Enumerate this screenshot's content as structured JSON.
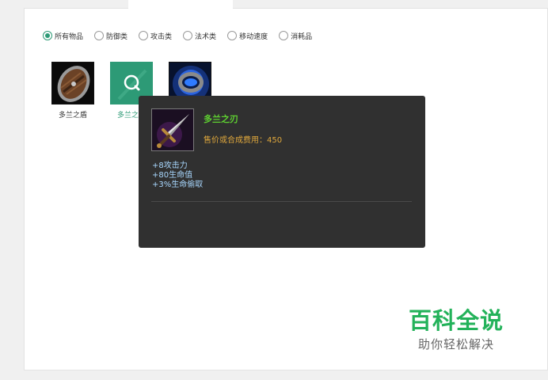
{
  "filters": [
    {
      "label": "所有物品",
      "checked": true
    },
    {
      "label": "防御类",
      "checked": false
    },
    {
      "label": "攻击类",
      "checked": false
    },
    {
      "label": "法术类",
      "checked": false
    },
    {
      "label": "移动速度",
      "checked": false
    },
    {
      "label": "消耗品",
      "checked": false
    }
  ],
  "items": [
    {
      "label": "多兰之盾",
      "icon": "shield-icon"
    },
    {
      "label": "多兰之刃",
      "icon": "search-icon"
    },
    {
      "label": "",
      "icon": "ring-icon"
    }
  ],
  "tooltip": {
    "name": "多兰之刃",
    "price": "售价或合成费用：450",
    "stats": [
      "+8攻击力",
      "+80生命值",
      "+3%生命偷取"
    ],
    "icon": "sword-icon"
  },
  "watermark": {
    "title": "百科全说",
    "subtitle": "助你轻松解决"
  },
  "colors": {
    "accent": "#2d9a76",
    "tooltip_bg": "#303030",
    "item_name": "#5ed130",
    "price": "#e0a83c",
    "stat": "#a9d8ff",
    "watermark": "#23b25a"
  }
}
